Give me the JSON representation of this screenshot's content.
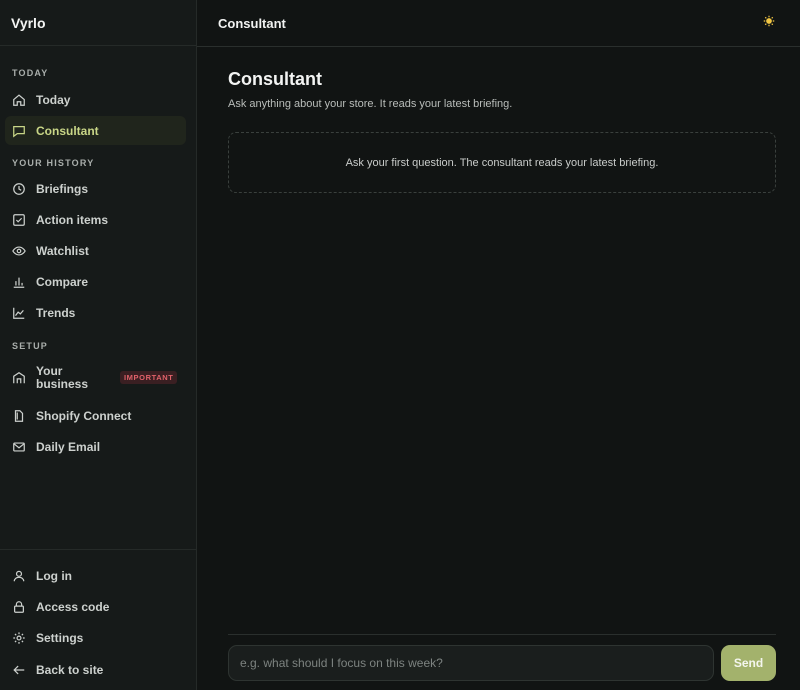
{
  "app": {
    "brand": "Vyrlo"
  },
  "sidebar": {
    "sections": [
      {
        "label": "TODAY"
      },
      {
        "label": "YOUR HISTORY"
      },
      {
        "label": "SETUP"
      }
    ],
    "items": [
      {
        "label": "Today",
        "icon": "home-icon"
      },
      {
        "label": "Consultant",
        "icon": "chat-icon",
        "active": true
      },
      {
        "label": "Briefings",
        "icon": "clock-icon"
      },
      {
        "label": "Action items",
        "icon": "checkbox-icon"
      },
      {
        "label": "Watchlist",
        "icon": "eye-icon"
      },
      {
        "label": "Compare",
        "icon": "bar-chart-icon"
      },
      {
        "label": "Trends",
        "icon": "line-chart-icon"
      },
      {
        "label": "Your business",
        "icon": "building-icon",
        "badge": "IMPORTANT"
      },
      {
        "label": "Shopify Connect",
        "icon": "document-icon"
      },
      {
        "label": "Daily Email",
        "icon": "mail-icon"
      }
    ],
    "footer": [
      {
        "label": "Log in",
        "icon": "user-icon"
      },
      {
        "label": "Access code",
        "icon": "lock-icon"
      },
      {
        "label": "Settings",
        "icon": "gear-icon"
      },
      {
        "label": "Back to site",
        "icon": "arrow-left-icon"
      }
    ]
  },
  "header": {
    "title": "Consultant",
    "theme_icon": "sun-icon"
  },
  "main": {
    "title": "Consultant",
    "subtitle": "Ask anything about your store. It reads your latest briefing.",
    "empty_state": "Ask your first question. The consultant reads your latest briefing."
  },
  "composer": {
    "placeholder": "e.g. what should I focus on this week?",
    "value": "",
    "send_label": "Send"
  },
  "colors": {
    "accent": "#a3b26c",
    "active_text": "#c9d687",
    "badge_text": "#e0626a",
    "sun": "#f2c744"
  }
}
